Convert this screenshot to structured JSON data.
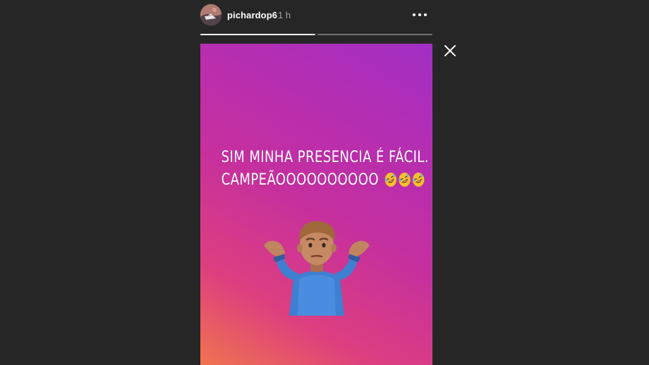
{
  "header": {
    "username": "pichardop6",
    "timestamp": "1 h",
    "more_icon": "more-horizontal-icon",
    "avatar_icon": "profile-avatar"
  },
  "progress": {
    "segments": [
      1.0,
      0.0
    ]
  },
  "close_icon": "close-icon",
  "story": {
    "text_line_1": "SIM MINHA PRESENCIA É FÁCIL.",
    "text_line_2": "CAMPEÃOOOOOOOOOO",
    "text_emoji": "rolling-on-floor-laughing-emoji",
    "text_emoji_count": 3,
    "sticker_emoji": "person-shrugging-emoji"
  },
  "colors": {
    "background": "#262626",
    "gradient_top_right": "#a12fc4",
    "gradient_middle": "#c52f9f",
    "gradient_bottom_left": "#f0734e"
  }
}
